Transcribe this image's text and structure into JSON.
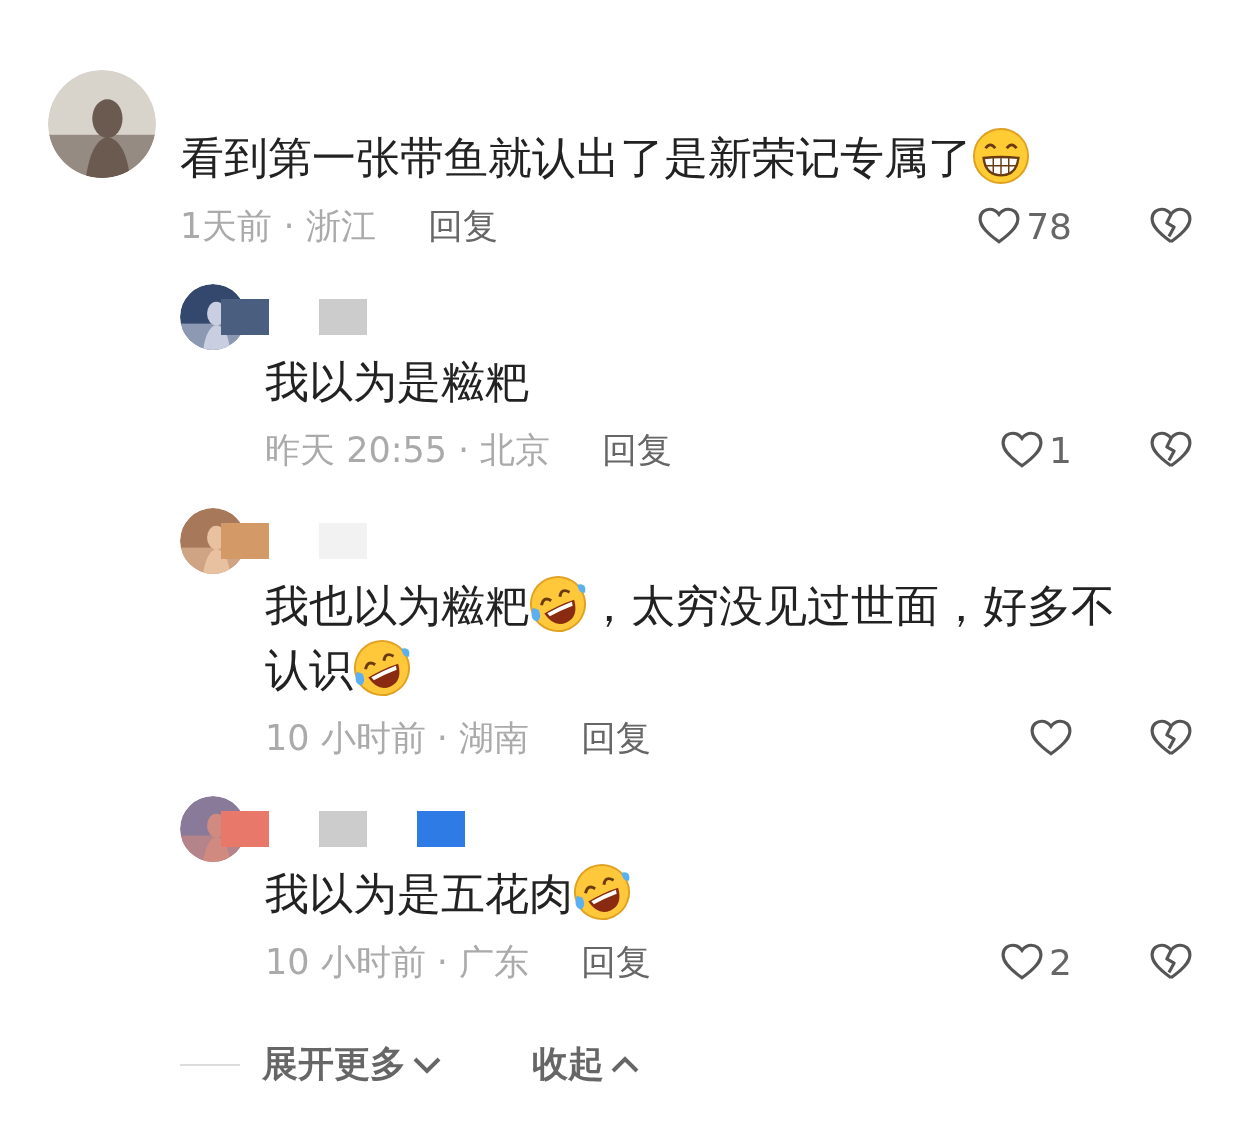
{
  "comment": {
    "segments": [
      {
        "kind": "text",
        "text": "看到第一张带鱼就认出了是新荣记专属了"
      },
      {
        "kind": "grin"
      }
    ],
    "meta": "1天前 · 浙江",
    "reply_label": "回复",
    "likes": "78"
  },
  "replies": [
    {
      "masks": [
        {
          "color": "#4a5f80"
        },
        {
          "color": "#cccccc"
        }
      ],
      "segments": [
        {
          "kind": "text",
          "text": "我以为是糍粑"
        }
      ],
      "meta": "昨天 20:55 · 北京",
      "reply_label": "回复",
      "likes": "1"
    },
    {
      "masks": [
        {
          "color": "#d39a68"
        },
        {
          "color": "#f2f2f2"
        }
      ],
      "segments": [
        {
          "kind": "text",
          "text": "我也以为糍粑"
        },
        {
          "kind": "rofl"
        },
        {
          "kind": "text",
          "text": "，太穷没见过世面，好多不认识"
        },
        {
          "kind": "rofl"
        }
      ],
      "meta": "10 小时前 · 湖南",
      "reply_label": "回复"
    },
    {
      "masks": [
        {
          "color": "#e8796a"
        },
        {
          "color": "#cccccc"
        },
        {
          "color": "#2f7be6"
        }
      ],
      "segments": [
        {
          "kind": "text",
          "text": "我以为是五花肉"
        },
        {
          "kind": "rofl"
        }
      ],
      "meta": "10 小时前 · 广东",
      "reply_label": "回复",
      "likes": "2"
    }
  ],
  "footer": {
    "expand": "展开更多",
    "collapse": "收起"
  }
}
